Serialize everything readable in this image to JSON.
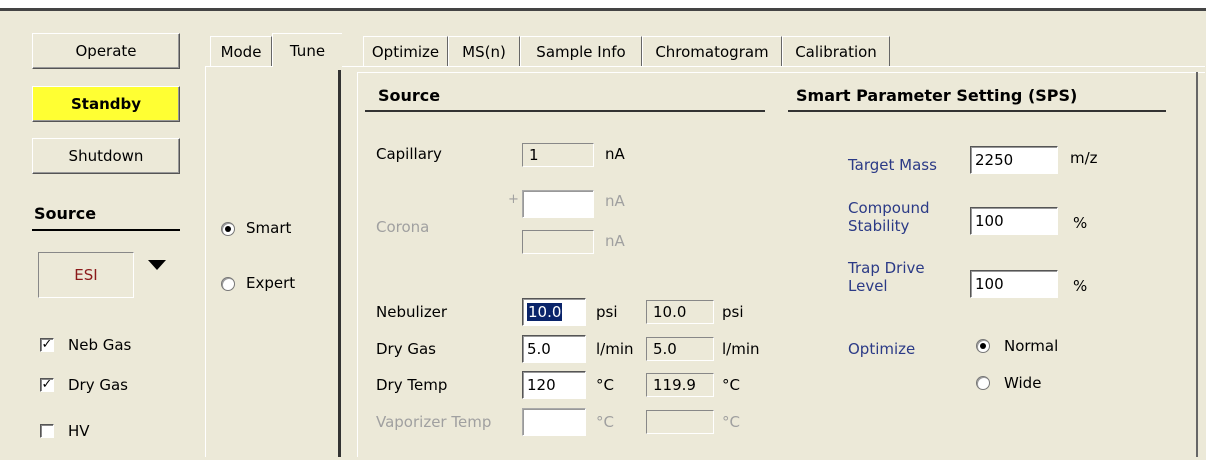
{
  "left_panel": {
    "buttons": {
      "operate": "Operate",
      "standby": "Standby",
      "shutdown": "Shutdown"
    },
    "source_header": "Source",
    "source_value": "ESI",
    "checkboxes": [
      {
        "label": "Neb Gas",
        "checked": true
      },
      {
        "label": "Dry Gas",
        "checked": true
      },
      {
        "label": "HV",
        "checked": false
      }
    ]
  },
  "tabs": {
    "mode": "Mode",
    "tune": "Tune",
    "optimize": "Optimize",
    "msn": "MS(n)",
    "sample_info": "Sample Info",
    "chromatogram": "Chromatogram",
    "calibration": "Calibration"
  },
  "mode_panel": {
    "smart": "Smart",
    "expert": "Expert",
    "selected": "Smart"
  },
  "source_panel": {
    "title": "Source",
    "capillary": {
      "label": "Capillary",
      "value": "1",
      "unit": "nA"
    },
    "corona": {
      "label": "Corona",
      "sign": "+",
      "unit": "nA",
      "unit2": "nA"
    },
    "nebulizer": {
      "label": "Nebulizer",
      "value": "10.0",
      "unit": "psi",
      "actual": "10.0",
      "actual_unit": "psi"
    },
    "dry_gas": {
      "label": "Dry Gas",
      "value": "5.0",
      "unit": "l/min",
      "actual": "5.0",
      "actual_unit": "l/min"
    },
    "dry_temp": {
      "label": "Dry Temp",
      "value": "120",
      "unit": "°C",
      "actual": "119.9",
      "actual_unit": "°C"
    },
    "vaporizer_temp": {
      "label": "Vaporizer Temp",
      "unit": "°C",
      "actual_unit": "°C"
    }
  },
  "sps_panel": {
    "title": "Smart Parameter Setting (SPS)",
    "target_mass": {
      "label": "Target Mass",
      "value": "2250",
      "unit": "m/z"
    },
    "compound_stability": {
      "label_line1": "Compound",
      "label_line2": "Stability",
      "value": "100",
      "unit": "%"
    },
    "trap_drive": {
      "label_line1": "Trap Drive",
      "label_line2": "Level",
      "value": "100",
      "unit": "%"
    },
    "optimize": {
      "label": "Optimize",
      "normal": "Normal",
      "wide": "Wide",
      "selected": "Normal"
    }
  },
  "colors": {
    "standby": "#ffff33",
    "panel": "#ece9d8",
    "label_blue": "#2b3a86",
    "source_text": "#8b1a1a"
  }
}
